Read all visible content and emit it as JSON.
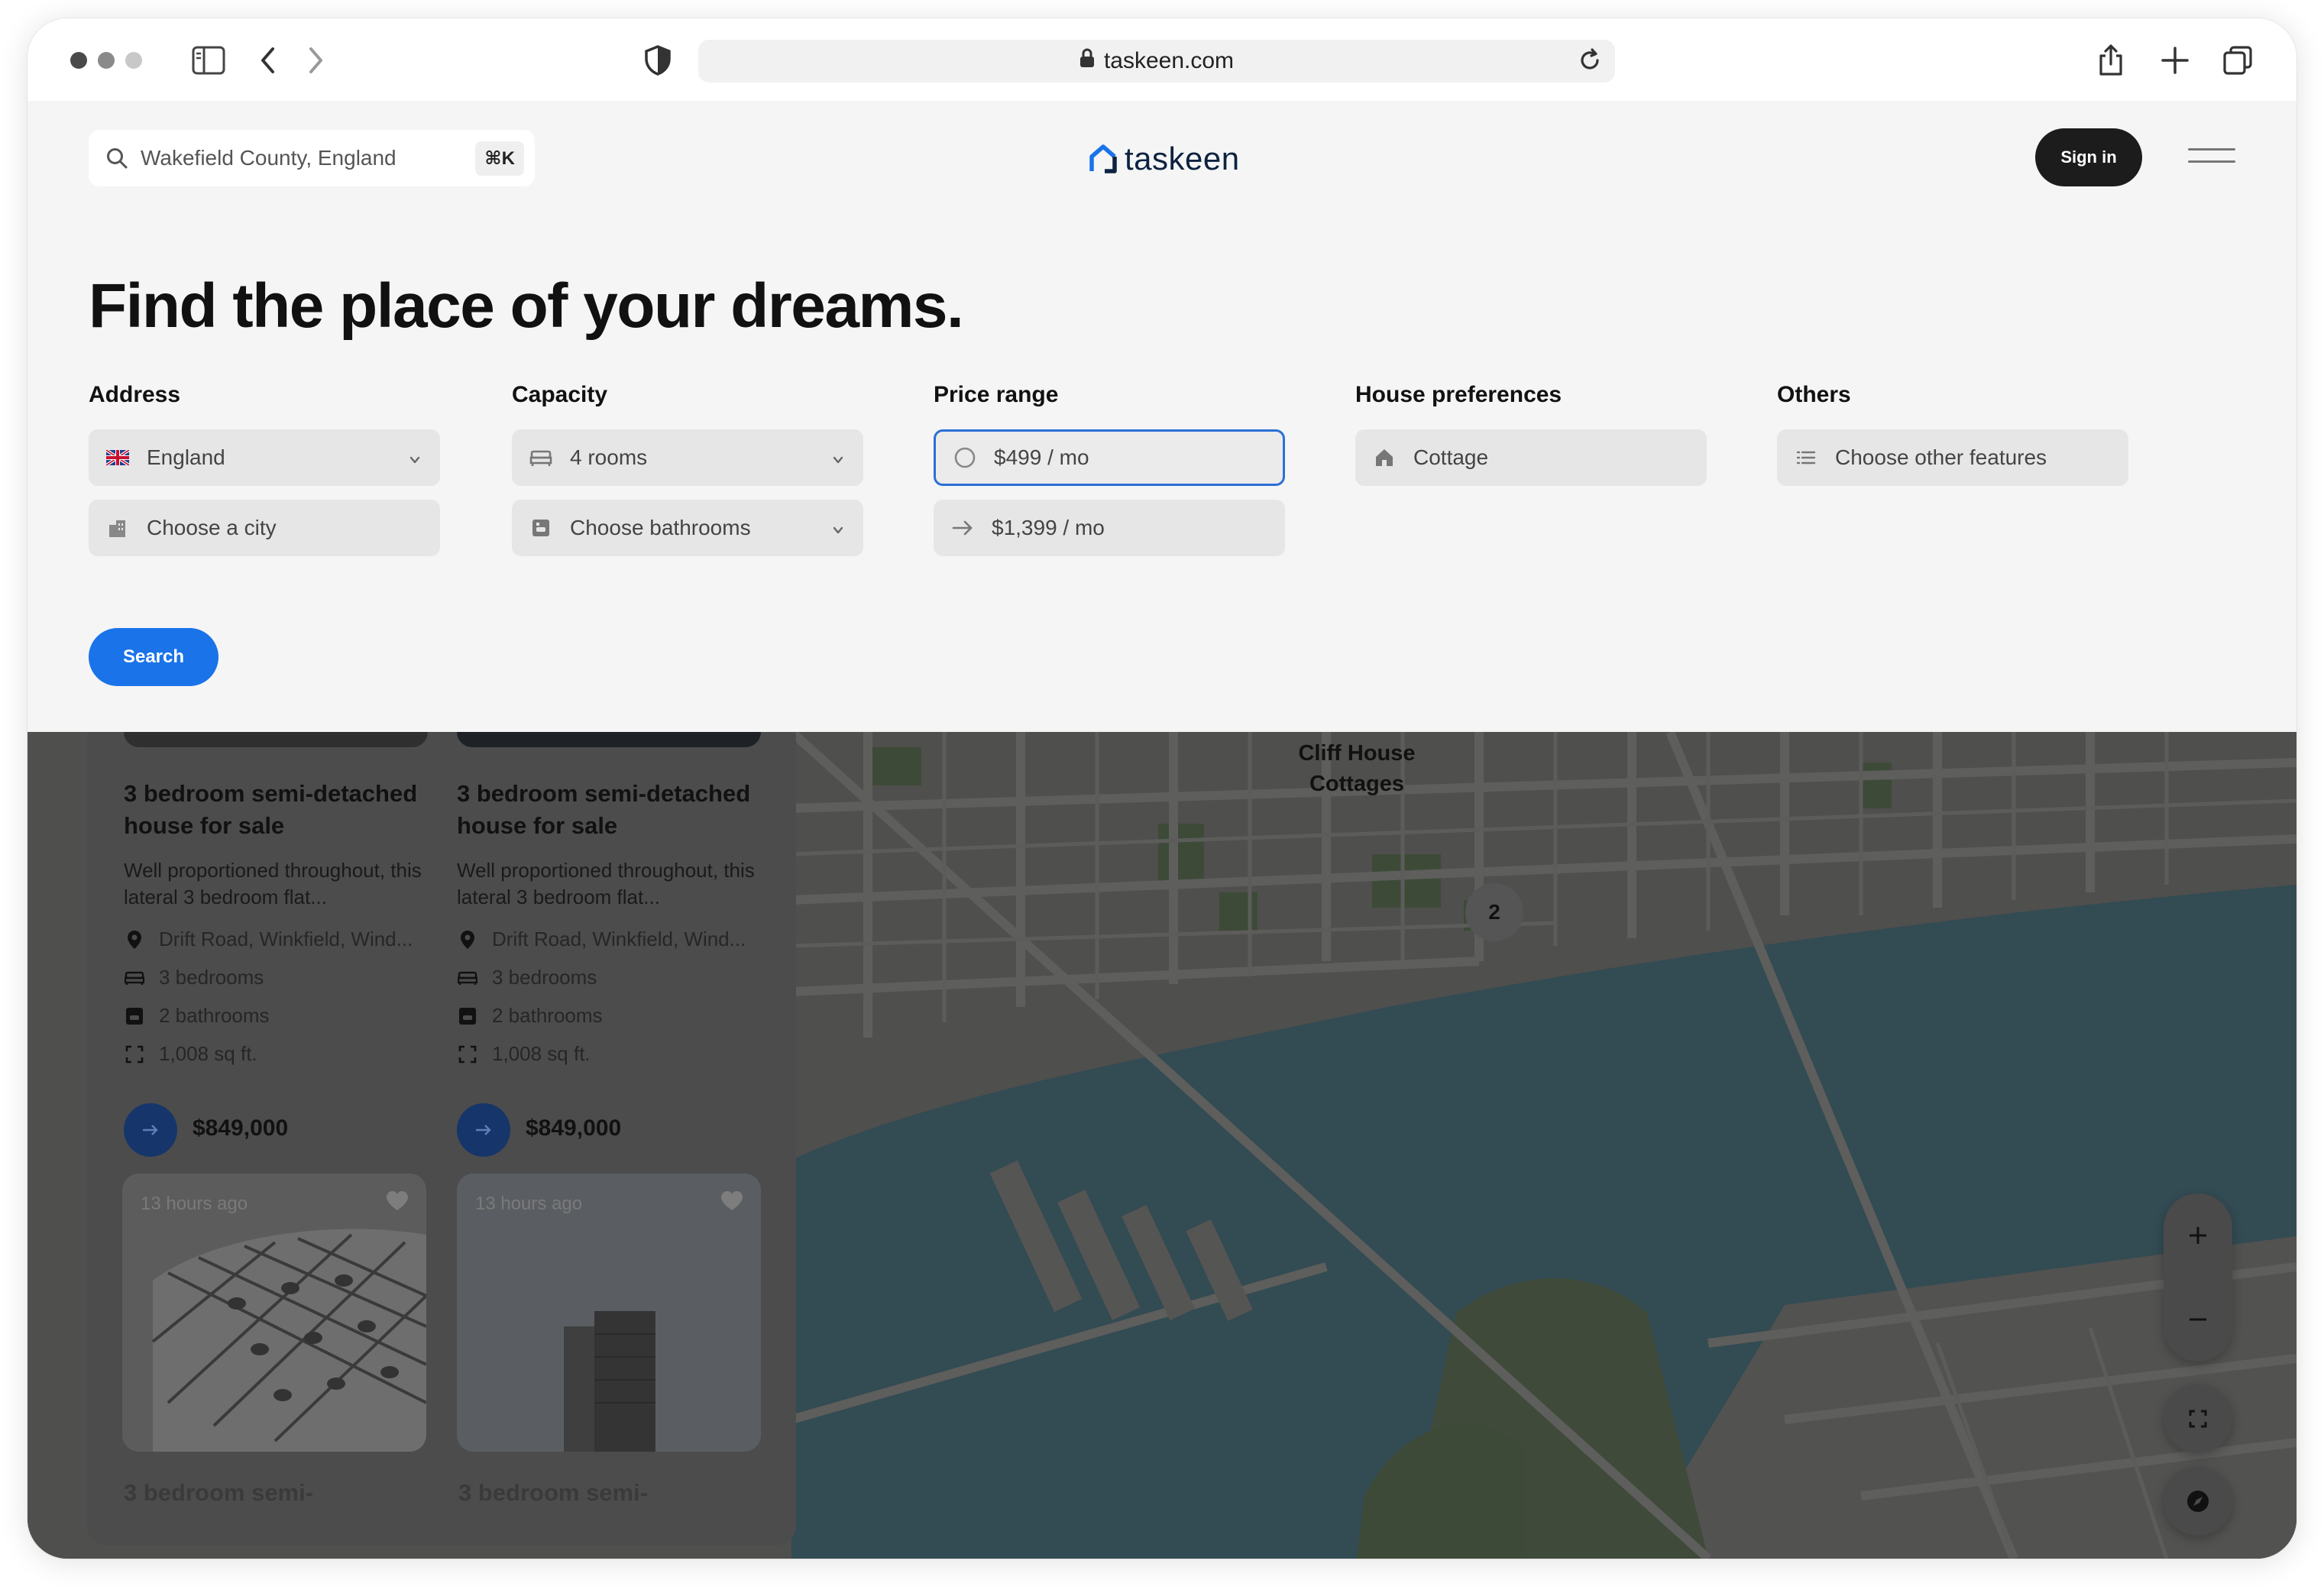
{
  "browser": {
    "url": "taskeen.com"
  },
  "header": {
    "search_value": "Wakefield County, England",
    "search_shortcut": "⌘K",
    "logo_text": "taskeen",
    "signin_label": "Sign in"
  },
  "hero": {
    "headline": "Find the place of your dreams."
  },
  "filters": {
    "address": {
      "label": "Address",
      "country": "England",
      "city_placeholder": "Choose a city"
    },
    "capacity": {
      "label": "Capacity",
      "rooms": "4 rooms",
      "bathrooms_placeholder": "Choose bathrooms"
    },
    "price": {
      "label": "Price range",
      "min": "$499 / mo",
      "max": "$1,399 / mo"
    },
    "preferences": {
      "label": "House preferences",
      "type": "Cottage"
    },
    "others": {
      "label": "Others",
      "placeholder": "Choose other features"
    },
    "search_button": "Search"
  },
  "listings": [
    {
      "title": "3 bedroom semi-detached house for sale",
      "description": "Well proportioned throughout, this lateral 3 bedroom flat...",
      "address": "Drift Road, Winkfield, Wind...",
      "bedrooms": "3 bedrooms",
      "bathrooms": "2 bathrooms",
      "area": "1,008 sq ft.",
      "price": "$849,000"
    },
    {
      "title": "3 bedroom semi-detached house for sale",
      "description": "Well proportioned throughout, this lateral 3 bedroom flat...",
      "address": "Drift Road, Winkfield, Wind...",
      "bedrooms": "3 bedrooms",
      "bathrooms": "2 bathrooms",
      "area": "1,008 sq ft.",
      "price": "$849,000"
    }
  ],
  "tiles": [
    {
      "time_ago": "13 hours ago",
      "title_faded": "3 bedroom semi-"
    },
    {
      "time_ago": "13 hours ago",
      "title_faded": "3 bedroom semi-"
    }
  ],
  "map": {
    "place_label": "Cliff House Cottages",
    "cluster_count": "2"
  },
  "colors": {
    "accent": "#1a73e8",
    "dark": "#1c1c1c",
    "logo": "#0d2240"
  }
}
